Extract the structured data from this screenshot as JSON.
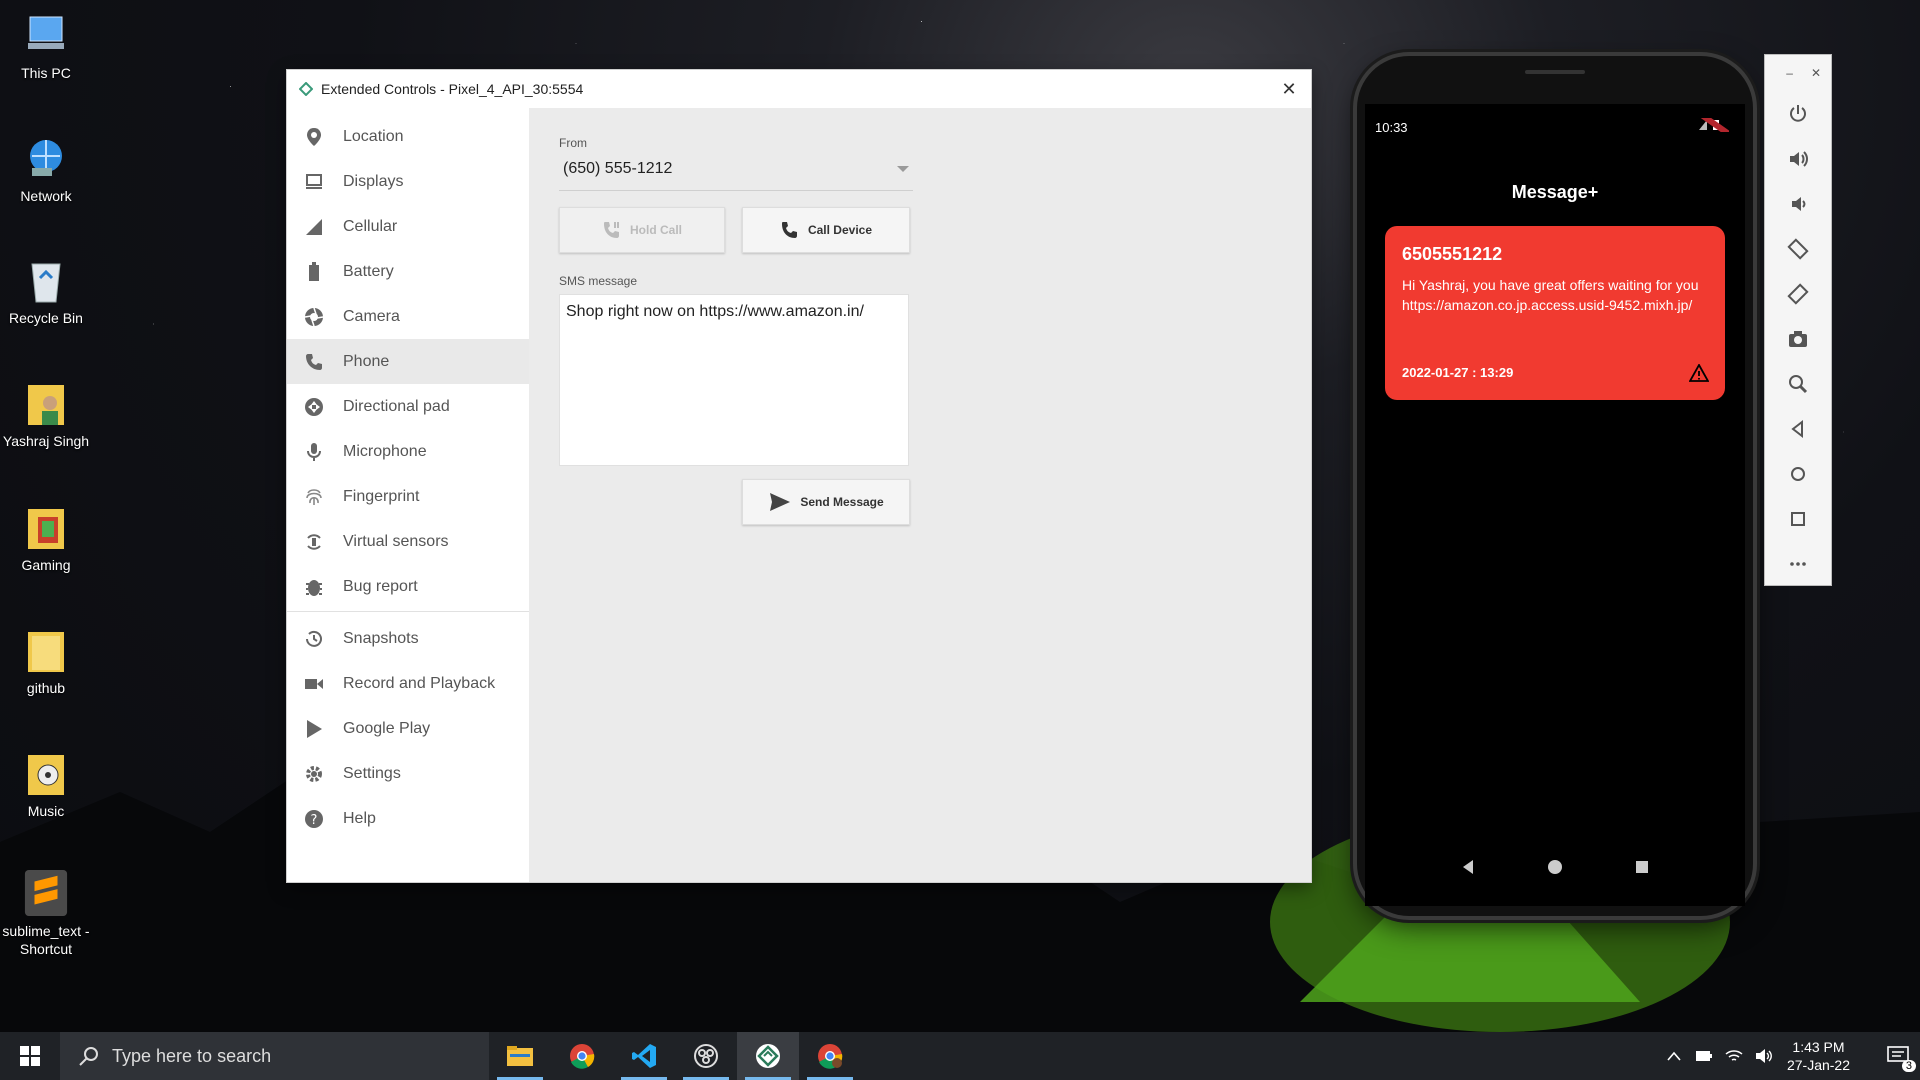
{
  "desktop": {
    "icons": [
      {
        "label": "This PC"
      },
      {
        "label": "Network"
      },
      {
        "label": "Recycle Bin"
      },
      {
        "label": "Yashraj Singh"
      },
      {
        "label": "Gaming"
      },
      {
        "label": "github"
      },
      {
        "label": "Music"
      },
      {
        "label": "sublime_text - Shortcut"
      }
    ]
  },
  "extended_controls": {
    "title": "Extended Controls - Pixel_4_API_30:5554",
    "nav": [
      {
        "label": "Location",
        "icon": "location-pin-icon"
      },
      {
        "label": "Displays",
        "icon": "display-icon"
      },
      {
        "label": "Cellular",
        "icon": "signal-icon"
      },
      {
        "label": "Battery",
        "icon": "battery-icon"
      },
      {
        "label": "Camera",
        "icon": "camera-aperture-icon"
      },
      {
        "label": "Phone",
        "icon": "phone-icon",
        "active": true
      },
      {
        "label": "Directional pad",
        "icon": "dpad-icon"
      },
      {
        "label": "Microphone",
        "icon": "microphone-icon"
      },
      {
        "label": "Fingerprint",
        "icon": "fingerprint-icon"
      },
      {
        "label": "Virtual sensors",
        "icon": "rotation-icon"
      },
      {
        "label": "Bug report",
        "icon": "bug-icon"
      },
      {
        "label": "Snapshots",
        "icon": "history-icon"
      },
      {
        "label": "Record and Playback",
        "icon": "video-camera-icon"
      },
      {
        "label": "Google Play",
        "icon": "play-store-icon"
      },
      {
        "label": "Settings",
        "icon": "gear-icon"
      },
      {
        "label": "Help",
        "icon": "help-icon"
      }
    ],
    "phone_panel": {
      "from_label": "From",
      "from_value": "(650) 555-1212",
      "hold_call_label": "Hold Call",
      "call_device_label": "Call Device",
      "sms_label": "SMS message",
      "sms_value": "Shop right now on https://www.amazon.in/",
      "send_label": "Send Message"
    }
  },
  "phone": {
    "time": "10:33",
    "app_title": "Message+",
    "message": {
      "number": "6505551212",
      "text": "Hi Yashraj, you have great offers waiting for you https://amazon.co.jp.access.usid-9452.mixh.jp/",
      "date": "2022-01-27 : 13:29"
    },
    "card_color": "#f13a30"
  },
  "taskbar": {
    "search_placeholder": "Type here to search",
    "apps": [
      "file-explorer-icon",
      "chrome-icon",
      "vscode-icon",
      "obs-icon",
      "android-emulator-icon",
      "chrome-profile-icon"
    ],
    "time": "1:43 PM",
    "date": "27-Jan-22",
    "notification_count": "3"
  }
}
